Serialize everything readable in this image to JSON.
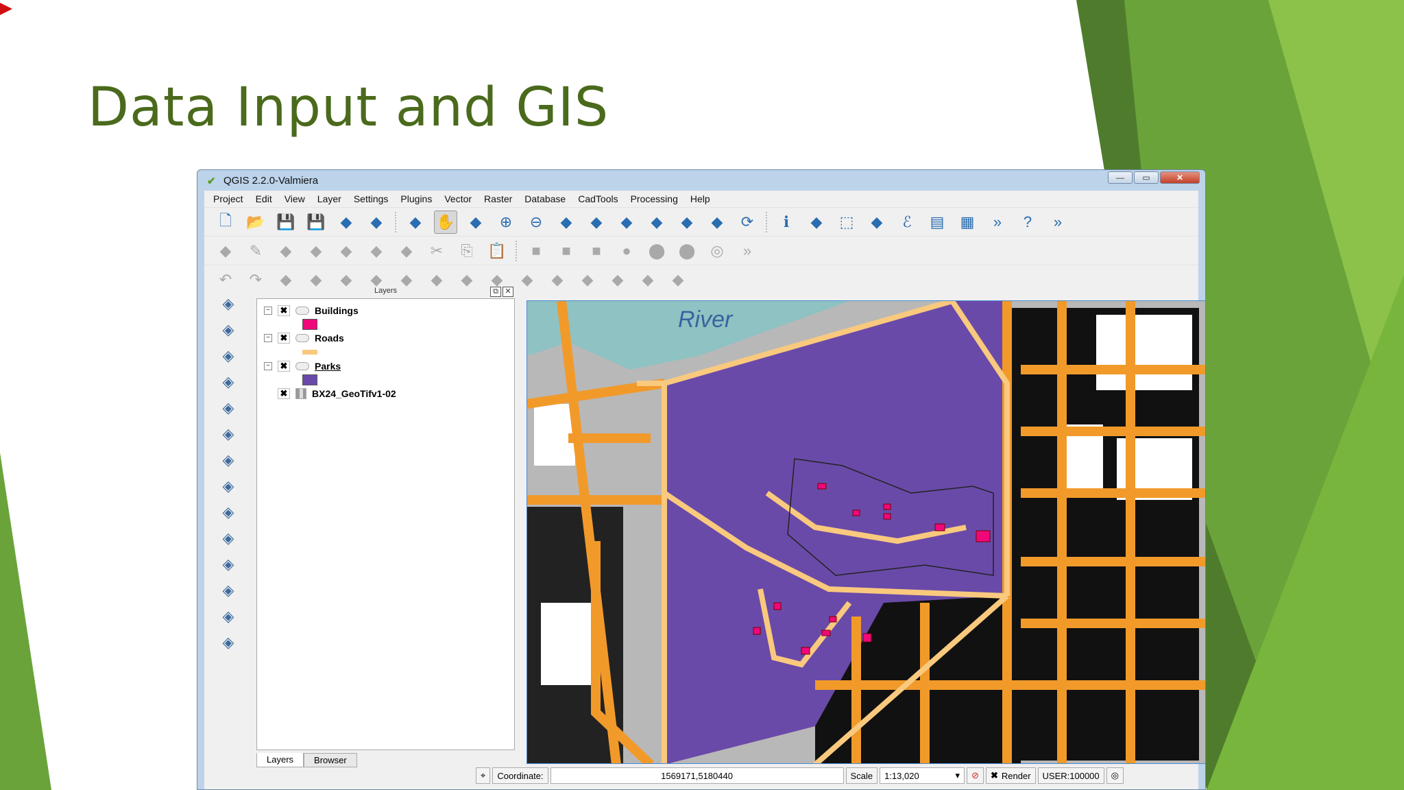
{
  "slide": {
    "title": "Data Input and GIS"
  },
  "window": {
    "title": "QGIS 2.2.0-Valmiera",
    "minimize": "—",
    "maximize": "▭",
    "close": "✕"
  },
  "menu": [
    "Project",
    "Edit",
    "View",
    "Layer",
    "Settings",
    "Plugins",
    "Vector",
    "Raster",
    "Database",
    "CadTools",
    "Processing",
    "Help"
  ],
  "toolbar_rows": [
    [
      "new-project",
      "open-project",
      "save-project",
      "save-as",
      "new-print-composer",
      "composer-manager",
      "sep",
      "touch-zoom",
      "pan",
      "pan-to-selection",
      "zoom-in",
      "zoom-out",
      "zoom-native",
      "zoom-full",
      "zoom-to-selection",
      "zoom-to-layer",
      "zoom-last",
      "zoom-next",
      "refresh",
      "sep",
      "identify",
      "action",
      "select",
      "deselect",
      "expression",
      "attribute-table",
      "field-calculator",
      "more",
      "help",
      "more"
    ],
    [
      "toggle-editing",
      "edit-pencil",
      "save-edits",
      "add-feature",
      "move-feature",
      "node-tool",
      "delete-selected",
      "cut",
      "copy",
      "paste",
      "sep",
      "rectangle",
      "square",
      "square-center",
      "circle",
      "circle-filled",
      "circle-big",
      "spiral",
      "more"
    ],
    [
      "undo",
      "redo",
      "simplify",
      "rotate",
      "add-ring",
      "add-part",
      "fill-ring",
      "delete-ring",
      "delete-part",
      "reshape",
      "offset-curve",
      "split-features",
      "split-parts",
      "merge",
      "point-on-line",
      "rotate-label"
    ]
  ],
  "left_toolbar": [
    "add-vector-layer",
    "add-raster-layer",
    "add-postgis-layer",
    "add-spatialite-layer",
    "add-mssql-layer",
    "add-oracle-layer",
    "add-wms-layer",
    "add-wcs-layer",
    "add-wfs-layer",
    "add-delimited-text",
    "new-shapefile",
    "new-spatialite",
    "georeferencer",
    "plugin"
  ],
  "layers": {
    "title": "Layers",
    "items": [
      {
        "name": "Buildings",
        "symbol": "#f0087a",
        "type": "polygon"
      },
      {
        "name": "Roads",
        "symbol": "#f9c97e",
        "type": "line"
      },
      {
        "name": "Parks",
        "symbol": "#6a4aa8",
        "type": "polygon"
      },
      {
        "name": "BX24_GeoTifv1-02",
        "type": "raster"
      }
    ],
    "tabs": [
      "Layers",
      "Browser"
    ]
  },
  "map": {
    "label": "River"
  },
  "status": {
    "coordinate_label": "Coordinate:",
    "coordinate": "1569171,5180440",
    "scale_label": "Scale",
    "scale": "1:13,020",
    "render": "Render",
    "crs": "USER:100000"
  }
}
